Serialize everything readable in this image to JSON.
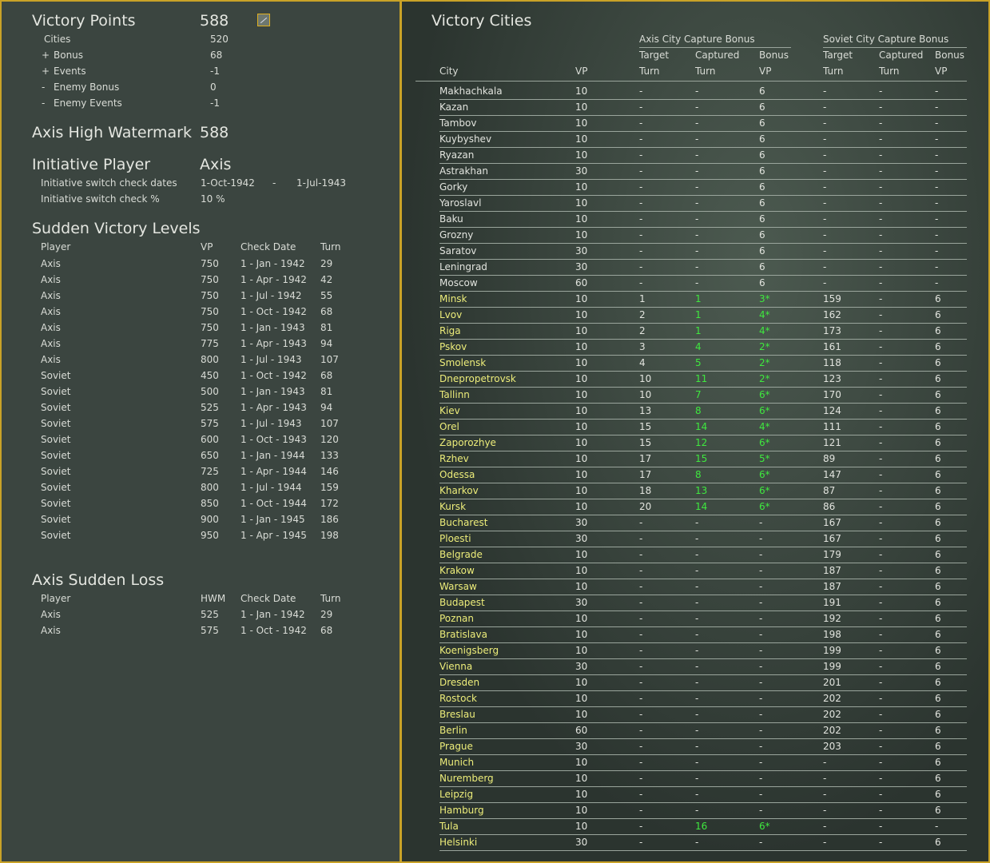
{
  "vp": {
    "title": "Victory Points",
    "total": "588",
    "rows": [
      {
        "sign": "",
        "label": "Cities",
        "value": "520"
      },
      {
        "sign": "+",
        "label": "Bonus",
        "value": "68"
      },
      {
        "sign": "+",
        "label": "Events",
        "value": "-1"
      },
      {
        "sign": "-",
        "label": "Enemy Bonus",
        "value": "0"
      },
      {
        "sign": "-",
        "label": "Enemy Events",
        "value": "-1"
      }
    ]
  },
  "hwm": {
    "title": "Axis High Watermark",
    "value": "588"
  },
  "initiative": {
    "title": "Initiative Player",
    "value": "Axis",
    "dates_label": "Initiative switch check dates",
    "date_from": "1-Oct-1942",
    "dash": "-",
    "date_to": "1-Jul-1943",
    "pct_label": "Initiative switch check %",
    "pct": "10 %"
  },
  "svl": {
    "title": "Sudden Victory Levels",
    "headers": [
      "Player",
      "VP",
      "Check Date",
      "Turn"
    ],
    "rows": [
      [
        "Axis",
        "750",
        "1 - Jan - 1942",
        "29"
      ],
      [
        "Axis",
        "750",
        "1 - Apr - 1942",
        "42"
      ],
      [
        "Axis",
        "750",
        "1 - Jul - 1942",
        "55"
      ],
      [
        "Axis",
        "750",
        "1 - Oct - 1942",
        "68"
      ],
      [
        "Axis",
        "750",
        "1 - Jan - 1943",
        "81"
      ],
      [
        "Axis",
        "775",
        "1 - Apr - 1943",
        "94"
      ],
      [
        "Axis",
        "800",
        "1 - Jul - 1943",
        "107"
      ],
      [
        "Soviet",
        "450",
        "1 - Oct - 1942",
        "68"
      ],
      [
        "Soviet",
        "500",
        "1 - Jan - 1943",
        "81"
      ],
      [
        "Soviet",
        "525",
        "1 - Apr - 1943",
        "94"
      ],
      [
        "Soviet",
        "575",
        "1 - Jul - 1943",
        "107"
      ],
      [
        "Soviet",
        "600",
        "1 - Oct - 1943",
        "120"
      ],
      [
        "Soviet",
        "650",
        "1 - Jan - 1944",
        "133"
      ],
      [
        "Soviet",
        "725",
        "1 - Apr - 1944",
        "146"
      ],
      [
        "Soviet",
        "800",
        "1 - Jul - 1944",
        "159"
      ],
      [
        "Soviet",
        "850",
        "1 - Oct - 1944",
        "172"
      ],
      [
        "Soviet",
        "900",
        "1 - Jan - 1945",
        "186"
      ],
      [
        "Soviet",
        "950",
        "1 - Apr - 1945",
        "198"
      ]
    ]
  },
  "asl": {
    "title": "Axis Sudden Loss",
    "headers": [
      "Player",
      "HWM",
      "Check Date",
      "Turn"
    ],
    "rows": [
      [
        "Axis",
        "525",
        "1 - Jan - 1942",
        "29"
      ],
      [
        "Axis",
        "575",
        "1 - Oct - 1942",
        "68"
      ]
    ]
  },
  "vc": {
    "title": "Victory Cities",
    "group_axis": "Axis City Capture Bonus",
    "group_soviet": "Soviet City Capture Bonus",
    "headers_top": [
      "",
      "",
      "Target",
      "Captured",
      "Bonus",
      "Target",
      "Captured",
      "Bonus"
    ],
    "headers": [
      "City",
      "VP",
      "Turn",
      "Turn",
      "VP",
      "Turn",
      "Turn",
      "VP"
    ],
    "rows": [
      [
        "w",
        "Makhachkala",
        "10",
        "-",
        "-",
        "6",
        "-",
        "-",
        "-"
      ],
      [
        "w",
        "Kazan",
        "10",
        "-",
        "-",
        "6",
        "-",
        "-",
        "-"
      ],
      [
        "w",
        "Tambov",
        "10",
        "-",
        "-",
        "6",
        "-",
        "-",
        "-"
      ],
      [
        "w",
        "Kuybyshev",
        "10",
        "-",
        "-",
        "6",
        "-",
        "-",
        "-"
      ],
      [
        "w",
        "Ryazan",
        "10",
        "-",
        "-",
        "6",
        "-",
        "-",
        "-"
      ],
      [
        "w",
        "Astrakhan",
        "30",
        "-",
        "-",
        "6",
        "-",
        "-",
        "-"
      ],
      [
        "w",
        "Gorky",
        "10",
        "-",
        "-",
        "6",
        "-",
        "-",
        "-"
      ],
      [
        "w",
        "Yaroslavl",
        "10",
        "-",
        "-",
        "6",
        "-",
        "-",
        "-"
      ],
      [
        "w",
        "Baku",
        "10",
        "-",
        "-",
        "6",
        "-",
        "-",
        "-"
      ],
      [
        "w",
        "Grozny",
        "10",
        "-",
        "-",
        "6",
        "-",
        "-",
        "-"
      ],
      [
        "w",
        "Saratov",
        "30",
        "-",
        "-",
        "6",
        "-",
        "-",
        "-"
      ],
      [
        "w",
        "Leningrad",
        "30",
        "-",
        "-",
        "6",
        "-",
        "-",
        "-"
      ],
      [
        "w",
        "Moscow",
        "60",
        "-",
        "-",
        "6",
        "-",
        "-",
        "-"
      ],
      [
        "y",
        "Minsk",
        "10",
        "1",
        "1",
        "3*",
        "159",
        "-",
        "6"
      ],
      [
        "y",
        "Lvov",
        "10",
        "2",
        "1",
        "4*",
        "162",
        "-",
        "6"
      ],
      [
        "y",
        "Riga",
        "10",
        "2",
        "1",
        "4*",
        "173",
        "-",
        "6"
      ],
      [
        "y",
        "Pskov",
        "10",
        "3",
        "4",
        "2*",
        "161",
        "-",
        "6"
      ],
      [
        "y",
        "Smolensk",
        "10",
        "4",
        "5",
        "2*",
        "118",
        "-",
        "6"
      ],
      [
        "y",
        "Dnepropetrovsk",
        "10",
        "10",
        "11",
        "2*",
        "123",
        "-",
        "6"
      ],
      [
        "y",
        "Tallinn",
        "10",
        "10",
        "7",
        "6*",
        "170",
        "-",
        "6"
      ],
      [
        "y",
        "Kiev",
        "10",
        "13",
        "8",
        "6*",
        "124",
        "-",
        "6"
      ],
      [
        "y",
        "Orel",
        "10",
        "15",
        "14",
        "4*",
        "111",
        "-",
        "6"
      ],
      [
        "y",
        "Zaporozhye",
        "10",
        "15",
        "12",
        "6*",
        "121",
        "-",
        "6"
      ],
      [
        "y",
        "Rzhev",
        "10",
        "17",
        "15",
        "5*",
        "89",
        "-",
        "6"
      ],
      [
        "y",
        "Odessa",
        "10",
        "17",
        "8",
        "6*",
        "147",
        "-",
        "6"
      ],
      [
        "y",
        "Kharkov",
        "10",
        "18",
        "13",
        "6*",
        "87",
        "-",
        "6"
      ],
      [
        "y",
        "Kursk",
        "10",
        "20",
        "14",
        "6*",
        "86",
        "-",
        "6"
      ],
      [
        "y",
        "Bucharest",
        "30",
        "-",
        "-",
        "-",
        "167",
        "-",
        "6"
      ],
      [
        "y",
        "Ploesti",
        "30",
        "-",
        "-",
        "-",
        "167",
        "-",
        "6"
      ],
      [
        "y",
        "Belgrade",
        "10",
        "-",
        "-",
        "-",
        "179",
        "-",
        "6"
      ],
      [
        "y",
        "Krakow",
        "10",
        "-",
        "-",
        "-",
        "187",
        "-",
        "6"
      ],
      [
        "y",
        "Warsaw",
        "10",
        "-",
        "-",
        "-",
        "187",
        "-",
        "6"
      ],
      [
        "y",
        "Budapest",
        "30",
        "-",
        "-",
        "-",
        "191",
        "-",
        "6"
      ],
      [
        "y",
        "Poznan",
        "10",
        "-",
        "-",
        "-",
        "192",
        "-",
        "6"
      ],
      [
        "y",
        "Bratislava",
        "10",
        "-",
        "-",
        "-",
        "198",
        "-",
        "6"
      ],
      [
        "y",
        "Koenigsberg",
        "10",
        "-",
        "-",
        "-",
        "199",
        "-",
        "6"
      ],
      [
        "y",
        "Vienna",
        "30",
        "-",
        "-",
        "-",
        "199",
        "-",
        "6"
      ],
      [
        "y",
        "Dresden",
        "10",
        "-",
        "-",
        "-",
        "201",
        "-",
        "6"
      ],
      [
        "y",
        "Rostock",
        "10",
        "-",
        "-",
        "-",
        "202",
        "-",
        "6"
      ],
      [
        "y",
        "Breslau",
        "10",
        "-",
        "-",
        "-",
        "202",
        "-",
        "6"
      ],
      [
        "y",
        "Berlin",
        "60",
        "-",
        "-",
        "-",
        "202",
        "-",
        "6"
      ],
      [
        "y",
        "Prague",
        "30",
        "-",
        "-",
        "-",
        "203",
        "-",
        "6"
      ],
      [
        "y",
        "Munich",
        "10",
        "-",
        "-",
        "-",
        "-",
        "-",
        "6"
      ],
      [
        "y",
        "Nuremberg",
        "10",
        "-",
        "-",
        "-",
        "-",
        "-",
        "6"
      ],
      [
        "y",
        "Leipzig",
        "10",
        "-",
        "-",
        "-",
        "-",
        "-",
        "6"
      ],
      [
        "y",
        "Hamburg",
        "10",
        "-",
        "-",
        "-",
        "-",
        "-",
        "6"
      ],
      [
        "y",
        "Tula",
        "10",
        "-",
        "16",
        "6*",
        "-",
        "-",
        "-"
      ],
      [
        "y",
        "Helsinki",
        "30",
        "-",
        "-",
        "-",
        "-",
        "-",
        "6"
      ]
    ]
  }
}
